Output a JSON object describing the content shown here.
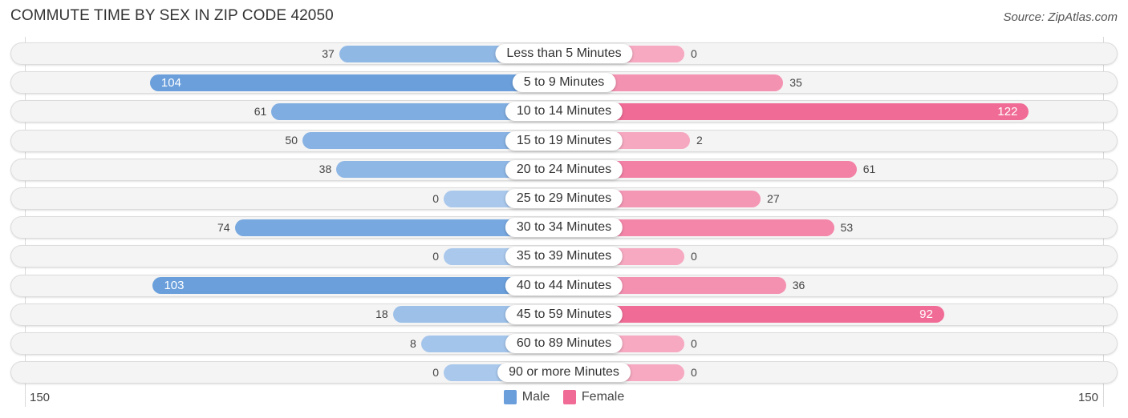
{
  "header": {
    "title": "COMMUTE TIME BY SEX IN ZIP CODE 42050",
    "source": "Source: ZipAtlas.com"
  },
  "colors": {
    "male": "#6a9fdb",
    "male_light": "#a9c8ec",
    "female": "#f06b96",
    "female_light": "#f6a9c1",
    "row_bg": "#f4f4f4"
  },
  "chart_data": {
    "type": "bar",
    "orientation": "horizontal-diverging",
    "title": "COMMUTE TIME BY SEX IN ZIP CODE 42050",
    "categories": [
      "Less than 5 Minutes",
      "5 to 9 Minutes",
      "10 to 14 Minutes",
      "15 to 19 Minutes",
      "20 to 24 Minutes",
      "25 to 29 Minutes",
      "30 to 34 Minutes",
      "35 to 39 Minutes",
      "40 to 44 Minutes",
      "45 to 59 Minutes",
      "60 to 89 Minutes",
      "90 or more Minutes"
    ],
    "series": [
      {
        "name": "Male",
        "side": "left",
        "values": [
          37,
          104,
          61,
          50,
          38,
          0,
          74,
          0,
          103,
          18,
          8,
          0
        ]
      },
      {
        "name": "Female",
        "side": "right",
        "values": [
          0,
          35,
          122,
          2,
          61,
          27,
          53,
          0,
          36,
          92,
          0,
          0
        ]
      }
    ],
    "axis": {
      "left_tick": "150",
      "right_tick": "150",
      "range": [
        150,
        150
      ]
    },
    "legend": {
      "position": "bottom-center",
      "entries": [
        "Male",
        "Female"
      ]
    },
    "grid": false
  }
}
